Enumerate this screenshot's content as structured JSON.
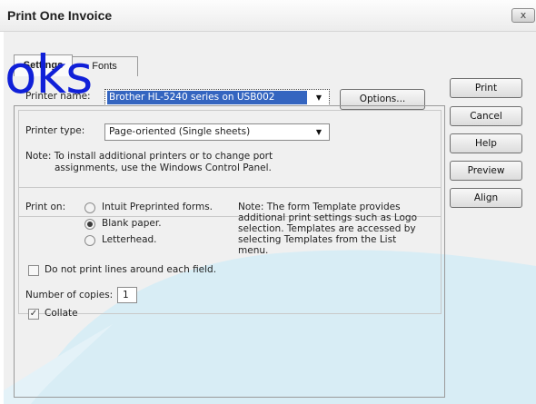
{
  "window": {
    "title": "Print One Invoice",
    "close_glyph": "x"
  },
  "overlay_text": "oks",
  "tabs": [
    {
      "label": "Settings"
    },
    {
      "label": "Fonts"
    }
  ],
  "printer": {
    "name_label": "Printer name:",
    "name_value": "Brother HL-5240 series on USB002",
    "options_button": "Options...",
    "type_label": "Printer type:",
    "type_value": "Page-oriented (Single sheets)",
    "note_line1": "Note: To install additional printers or to change port",
    "note_line2": "assignments, use the Windows Control Panel."
  },
  "print_on": {
    "label": "Print on:",
    "options": [
      {
        "label": "Intuit Preprinted forms.",
        "selected": false
      },
      {
        "label": "Blank paper.",
        "selected": true
      },
      {
        "label": "Letterhead.",
        "selected": false
      }
    ],
    "template_note": [
      "Note: The form Template provides",
      "additional print settings such as Logo",
      "selection.  Templates are accessed by",
      "selecting Templates from the List",
      "menu."
    ]
  },
  "do_not_print_lines": {
    "label": "Do not print lines around each field.",
    "checked": false
  },
  "copies": {
    "label": "Number of copies:",
    "value": "1"
  },
  "collate": {
    "label": "Collate",
    "checked": true
  },
  "buttons": {
    "print": "Print",
    "cancel": "Cancel",
    "help": "Help",
    "preview": "Preview",
    "align": "Align"
  },
  "colors": {
    "overlay": "#1020d8",
    "selection": "#3465c0",
    "swoosh": "#d8edf5"
  }
}
